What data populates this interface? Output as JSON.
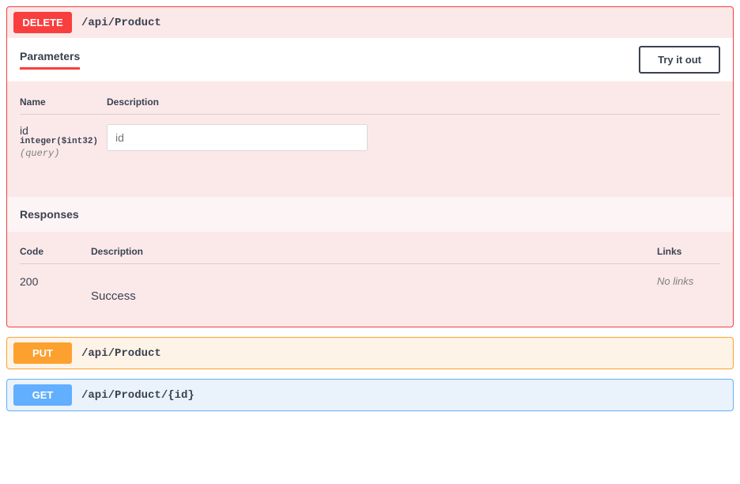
{
  "operations": {
    "delete": {
      "method": "DELETE",
      "path": "/api/Product",
      "sections": {
        "parameters_title": "Parameters",
        "tryout_label": "Try it out",
        "responses_title": "Responses"
      },
      "param_headers": {
        "name": "Name",
        "description": "Description"
      },
      "parameter": {
        "name": "id",
        "type": "integer($int32)",
        "in": "(query)",
        "placeholder": "id"
      },
      "resp_headers": {
        "code": "Code",
        "description": "Description",
        "links": "Links"
      },
      "response": {
        "code": "200",
        "description": "Success",
        "links": "No links"
      }
    },
    "put": {
      "method": "PUT",
      "path": "/api/Product"
    },
    "get": {
      "method": "GET",
      "path": "/api/Product/{id}"
    }
  }
}
